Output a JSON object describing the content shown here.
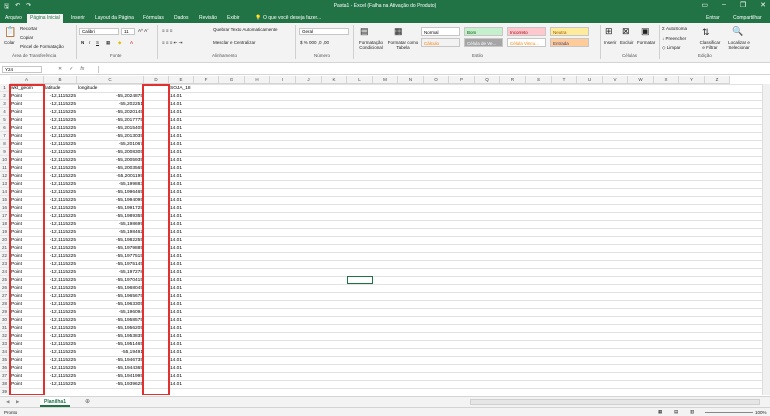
{
  "window": {
    "title": "Pasta1 - Excel (Falha na Ativação do Produto)"
  },
  "tabs": [
    "Arquivo",
    "Página Inicial",
    "Inserir",
    "Layout da Página",
    "Fórmulas",
    "Dados",
    "Revisão",
    "Exibir"
  ],
  "tell_me": "O que você deseja fazer...",
  "account": {
    "signin": "Entrar",
    "share": "Compartilhar"
  },
  "ribbon": {
    "clipboard": {
      "paste": "Colar",
      "cut": "Recortar",
      "copy": "Copiar",
      "format_painter": "Pincel de Formatação",
      "label": "Área de Transferência"
    },
    "font": {
      "name": "Calibri",
      "size": "11",
      "label": "Fonte"
    },
    "alignment": {
      "wrap": "Quebrar Texto Automaticamente",
      "merge": "Mesclar e Centralizar",
      "label": "Alinhamento"
    },
    "number": {
      "format": "Geral",
      "label": "Número"
    },
    "styles": {
      "cond": "Formatação Condicional",
      "table": "Formatar como Tabela",
      "label": "Estilo",
      "items": [
        {
          "name": "Normal",
          "bg": "#ffffff",
          "fg": "#000000"
        },
        {
          "name": "Bom",
          "bg": "#c6efce",
          "fg": "#006100"
        },
        {
          "name": "Incorreto",
          "bg": "#ffc7ce",
          "fg": "#9c0006"
        },
        {
          "name": "Neutra",
          "bg": "#ffeb9c",
          "fg": "#9c5700"
        },
        {
          "name": "Cálculo",
          "bg": "#f2f2f2",
          "fg": "#fa7d00"
        },
        {
          "name": "Célula de Ve...",
          "bg": "#a5a5a5",
          "fg": "#ffffff"
        },
        {
          "name": "Célula Vincu...",
          "bg": "#ffffff",
          "fg": "#fa7d00"
        },
        {
          "name": "Entrada",
          "bg": "#ffcc99",
          "fg": "#3f3f76"
        }
      ]
    },
    "cells": {
      "insert": "Inserir",
      "delete": "Excluir",
      "format": "Formatar",
      "label": "Células"
    },
    "editing": {
      "autosum": "AutoSoma",
      "fill": "Preencher",
      "clear": "Limpar",
      "sort": "Classificar e Filtrar",
      "find": "Localizar e Selecionar",
      "label": "Edição"
    }
  },
  "formula_bar": {
    "name_box": "Y24",
    "fx": "fx",
    "value": ""
  },
  "columns": [
    "A",
    "B",
    "C",
    "D",
    "E",
    "F",
    "G",
    "H",
    "I",
    "J",
    "K",
    "L",
    "M",
    "N",
    "O",
    "P",
    "Q",
    "R",
    "S",
    "T",
    "U",
    "V",
    "W",
    "X",
    "Y",
    "Z"
  ],
  "sheet": {
    "headers": [
      "wkt_geom",
      "latitude",
      "longitude",
      "",
      "SOJA_18"
    ],
    "rows": [
      [
        "Point",
        "-12,1115225",
        "-55,2024875",
        "",
        "14.01"
      ],
      [
        "Point",
        "-12,1115225",
        "-55,202251",
        "",
        "14.01"
      ],
      [
        "Point",
        "-12,1115225",
        "-55,2020145",
        "",
        "14.01"
      ],
      [
        "Point",
        "-12,1115225",
        "-55,2017775",
        "",
        "14.01"
      ],
      [
        "Point",
        "-12,1115225",
        "-55,2015405",
        "",
        "14.01"
      ],
      [
        "Point",
        "-12,1115225",
        "-55,2013035",
        "",
        "14.01"
      ],
      [
        "Point",
        "-12,1115225",
        "-55,201067",
        "",
        "14.01"
      ],
      [
        "Point",
        "-12,1115225",
        "-55,2008305",
        "",
        "14.01"
      ],
      [
        "Point",
        "-12,1115225",
        "-55,2005935",
        "",
        "14.01"
      ],
      [
        "Point",
        "-12,1115225",
        "-55,2003565",
        "",
        "14.01"
      ],
      [
        "Point",
        "-12,1115225",
        "-55,2001195",
        "",
        "14.01"
      ],
      [
        "Point",
        "-12,1115225",
        "-55,199883",
        "",
        "14.01"
      ],
      [
        "Point",
        "-12,1115225",
        "-55,1996465",
        "",
        "14.01"
      ],
      [
        "Point",
        "-12,1115225",
        "-55,1994095",
        "",
        "14.01"
      ],
      [
        "Point",
        "-12,1115225",
        "-55,1991725",
        "",
        "14.01"
      ],
      [
        "Point",
        "-12,1115225",
        "-55,1989355",
        "",
        "14.01"
      ],
      [
        "Point",
        "-12,1115225",
        "-55,198699",
        "",
        "14.01"
      ],
      [
        "Point",
        "-12,1115225",
        "-55,198462",
        "",
        "14.01"
      ],
      [
        "Point",
        "-12,1115225",
        "-55,1982255",
        "",
        "14.01"
      ],
      [
        "Point",
        "-12,1115225",
        "-55,1979885",
        "",
        "14.01"
      ],
      [
        "Point",
        "-12,1115225",
        "-55,1977515",
        "",
        "14.01"
      ],
      [
        "Point",
        "-12,1115225",
        "-55,1975145",
        "",
        "14.01"
      ],
      [
        "Point",
        "-12,1115225",
        "-55,197278",
        "",
        "14.01"
      ],
      [
        "Point",
        "-12,1115225",
        "-55,1970415",
        "",
        "14.01"
      ],
      [
        "Point",
        "-12,1115225",
        "-55,1968045",
        "",
        "14.01"
      ],
      [
        "Point",
        "-12,1115225",
        "-55,1965675",
        "",
        "14.01"
      ],
      [
        "Point",
        "-12,1115225",
        "-55,1963305",
        "",
        "14.01"
      ],
      [
        "Point",
        "-12,1115225",
        "-55,196094",
        "",
        "14.01"
      ],
      [
        "Point",
        "-12,1115225",
        "-55,1958575",
        "",
        "14.01"
      ],
      [
        "Point",
        "-12,1115225",
        "-55,1956205",
        "",
        "14.01"
      ],
      [
        "Point",
        "-12,1115225",
        "-55,1953835",
        "",
        "14.01"
      ],
      [
        "Point",
        "-12,1115225",
        "-55,1951465",
        "",
        "14.01"
      ],
      [
        "Point",
        "-12,1115225",
        "-55,19491",
        "",
        "14.01"
      ],
      [
        "Point",
        "-12,1115225",
        "-55,1946735",
        "",
        "14.01"
      ],
      [
        "Point",
        "-12,1115225",
        "-55,1944365",
        "",
        "14.01"
      ],
      [
        "Point",
        "-12,1115225",
        "-55,1941995",
        "",
        "14.01"
      ],
      [
        "Point",
        "-12,1115225",
        "-55,1939625",
        "",
        "14.01"
      ]
    ]
  },
  "sheet_tabs": [
    "Planilha1"
  ],
  "status": {
    "ready": "Pronto",
    "zoom": "100%"
  }
}
